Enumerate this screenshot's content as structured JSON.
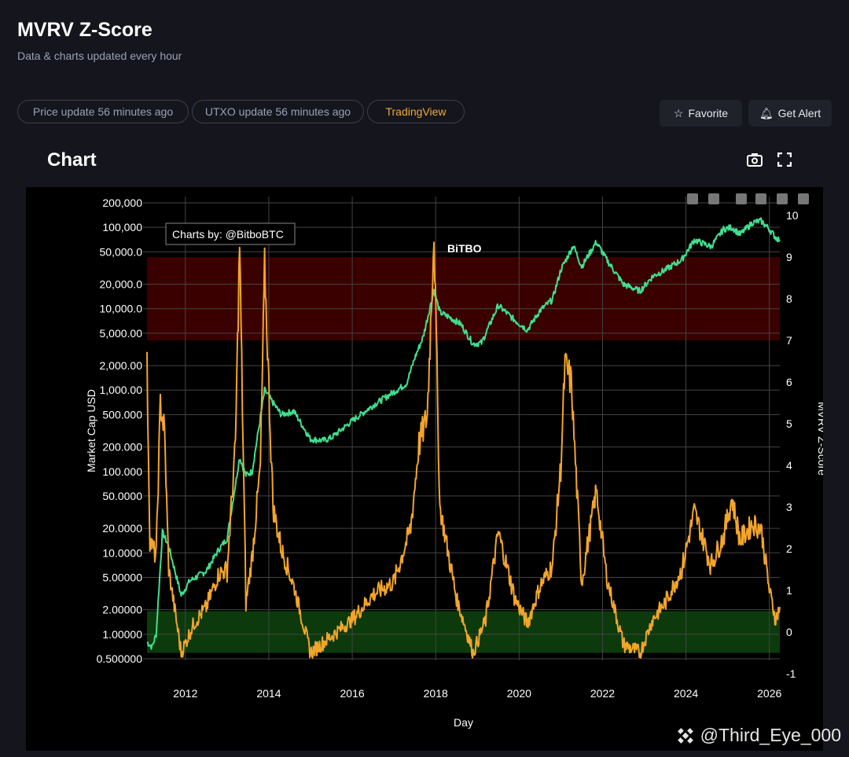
{
  "header": {
    "title": "MVRV Z-Score",
    "subtitle": "Data & charts updated every hour"
  },
  "pills": {
    "price": "Price update 56 minutes ago",
    "utxo": "UTXO update 56 minutes ago",
    "tradingview": "TradingView"
  },
  "buttons": {
    "favorite": "Favorite",
    "alert": "Get Alert"
  },
  "section": {
    "title": "Chart"
  },
  "watermark": "@Third_Eye_000",
  "colors": {
    "price": "#3fe08e",
    "zscore": "#f3a52a",
    "red_band": "#3a0000",
    "green_band": "#0c3a0c"
  },
  "chart_data": {
    "type": "line",
    "credit": "Charts by: @BitboBTC",
    "logo": "BiTBO",
    "xlabel": "Day",
    "ylabel": "Market Cap USD",
    "y2label": "MVRV Z-Score",
    "xlim": [
      2011.08,
      2026.25
    ],
    "x_ticks": [
      "2012",
      "2014",
      "2016",
      "2018",
      "2020",
      "2022",
      "2024",
      "2026"
    ],
    "ylim_log": [
      0.5,
      200000
    ],
    "y_ticks": [
      {
        "v": 200000,
        "label": "200,000"
      },
      {
        "v": 100000,
        "label": "100,000"
      },
      {
        "v": 50000,
        "label": "50,000.0"
      },
      {
        "v": 20000,
        "label": "20,000.0"
      },
      {
        "v": 10000,
        "label": "10,000.0"
      },
      {
        "v": 5000,
        "label": "5,000.00"
      },
      {
        "v": 2000,
        "label": "2,000.00"
      },
      {
        "v": 1000,
        "label": "1,000.00"
      },
      {
        "v": 500,
        "label": "500.000"
      },
      {
        "v": 200,
        "label": "200.000"
      },
      {
        "v": 100,
        "label": "100.000"
      },
      {
        "v": 50,
        "label": "50.0000"
      },
      {
        "v": 20,
        "label": "20.0000"
      },
      {
        "v": 10,
        "label": "10.0000"
      },
      {
        "v": 5,
        "label": "5.00000"
      },
      {
        "v": 2,
        "label": "2.00000"
      },
      {
        "v": 1,
        "label": "1.00000"
      },
      {
        "v": 0.5,
        "label": "0.500000"
      }
    ],
    "y2lim": [
      -1,
      10
    ],
    "y2_ticks": [
      "-1",
      "0",
      "1",
      "2",
      "3",
      "4",
      "5",
      "6",
      "7",
      "8",
      "9",
      "10"
    ],
    "bands": [
      {
        "name": "overvalued",
        "from": 7,
        "to": 9
      },
      {
        "name": "undervalued",
        "from": -0.5,
        "to": 0.5
      }
    ],
    "series": [
      {
        "name": "Price",
        "axis": "left",
        "points": [
          [
            2011.08,
            0.8
          ],
          [
            2011.2,
            0.7
          ],
          [
            2011.3,
            1
          ],
          [
            2011.45,
            18
          ],
          [
            2011.6,
            12
          ],
          [
            2011.9,
            3
          ],
          [
            2012.1,
            4.5
          ],
          [
            2012.5,
            6
          ],
          [
            2012.8,
            11
          ],
          [
            2013.0,
            15
          ],
          [
            2013.3,
            150
          ],
          [
            2013.45,
            90
          ],
          [
            2013.6,
            100
          ],
          [
            2013.9,
            1000
          ],
          [
            2014.1,
            700
          ],
          [
            2014.3,
            500
          ],
          [
            2014.6,
            550
          ],
          [
            2015.0,
            250
          ],
          [
            2015.3,
            240
          ],
          [
            2015.5,
            260
          ],
          [
            2016.0,
            420
          ],
          [
            2016.5,
            650
          ],
          [
            2017.0,
            950
          ],
          [
            2017.3,
            1200
          ],
          [
            2017.5,
            2500
          ],
          [
            2017.7,
            4500
          ],
          [
            2017.96,
            17000
          ],
          [
            2018.1,
            9000
          ],
          [
            2018.3,
            8000
          ],
          [
            2018.6,
            6500
          ],
          [
            2018.9,
            3700
          ],
          [
            2019.1,
            3800
          ],
          [
            2019.5,
            11000
          ],
          [
            2019.9,
            7200
          ],
          [
            2020.2,
            5500
          ],
          [
            2020.5,
            9500
          ],
          [
            2020.8,
            13000
          ],
          [
            2021.0,
            30000
          ],
          [
            2021.3,
            60000
          ],
          [
            2021.5,
            33000
          ],
          [
            2021.85,
            66000
          ],
          [
            2022.1,
            40000
          ],
          [
            2022.5,
            20000
          ],
          [
            2022.9,
            16500
          ],
          [
            2023.2,
            25000
          ],
          [
            2023.5,
            30000
          ],
          [
            2023.9,
            40000
          ],
          [
            2024.2,
            70000
          ],
          [
            2024.6,
            58000
          ],
          [
            2024.9,
            95000
          ],
          [
            2025.1,
            100000
          ],
          [
            2025.3,
            82000
          ],
          [
            2025.6,
            115000
          ],
          [
            2025.8,
            120000
          ],
          [
            2026.0,
            95000
          ],
          [
            2026.15,
            75000
          ],
          [
            2026.25,
            70000
          ]
        ]
      },
      {
        "name": "MVRV Z-Score",
        "axis": "right",
        "points": [
          [
            2011.08,
            6.4
          ],
          [
            2011.15,
            2.2
          ],
          [
            2011.3,
            1.8
          ],
          [
            2011.4,
            5.5
          ],
          [
            2011.5,
            4.8
          ],
          [
            2011.6,
            1.5
          ],
          [
            2011.9,
            -0.5
          ],
          [
            2012.2,
            0.2
          ],
          [
            2012.5,
            0.6
          ],
          [
            2012.8,
            1.4
          ],
          [
            2013.0,
            1.5
          ],
          [
            2013.2,
            4.5
          ],
          [
            2013.3,
            9.3
          ],
          [
            2013.45,
            0.7
          ],
          [
            2013.6,
            1.8
          ],
          [
            2013.8,
            4
          ],
          [
            2013.9,
            8.8
          ],
          [
            2014.1,
            3
          ],
          [
            2014.3,
            2
          ],
          [
            2014.6,
            1.1
          ],
          [
            2015.0,
            -0.5
          ],
          [
            2015.5,
            -0.1
          ],
          [
            2016.0,
            0.3
          ],
          [
            2016.5,
            0.9
          ],
          [
            2017.0,
            1.2
          ],
          [
            2017.4,
            2.5
          ],
          [
            2017.6,
            4.5
          ],
          [
            2017.8,
            5.2
          ],
          [
            2017.96,
            9.6
          ],
          [
            2018.1,
            3
          ],
          [
            2018.5,
            0.8
          ],
          [
            2018.9,
            -0.5
          ],
          [
            2019.2,
            0.3
          ],
          [
            2019.5,
            2.4
          ],
          [
            2019.9,
            0.8
          ],
          [
            2020.2,
            0.2
          ],
          [
            2020.5,
            1.1
          ],
          [
            2020.8,
            1.6
          ],
          [
            2021.0,
            4
          ],
          [
            2021.1,
            6.4
          ],
          [
            2021.25,
            6
          ],
          [
            2021.5,
            1.2
          ],
          [
            2021.85,
            3.4
          ],
          [
            2022.1,
            1.3
          ],
          [
            2022.5,
            -0.3
          ],
          [
            2022.9,
            -0.5
          ],
          [
            2023.2,
            0.3
          ],
          [
            2023.5,
            0.7
          ],
          [
            2023.9,
            1.5
          ],
          [
            2024.2,
            2.9
          ],
          [
            2024.6,
            1.6
          ],
          [
            2024.9,
            2.3
          ],
          [
            2025.1,
            3.2
          ],
          [
            2025.3,
            2.2
          ],
          [
            2025.6,
            2.6
          ],
          [
            2025.8,
            2.5
          ],
          [
            2026.0,
            1.0
          ],
          [
            2026.15,
            0.3
          ],
          [
            2026.25,
            0.6
          ]
        ]
      }
    ]
  }
}
